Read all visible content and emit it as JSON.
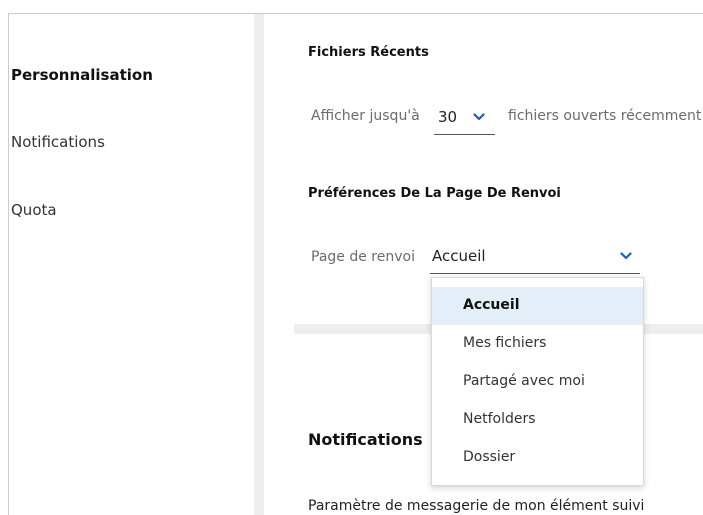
{
  "sidebar": {
    "items": [
      {
        "label": "Personnalisation",
        "active": true
      },
      {
        "label": "Notifications",
        "active": false
      },
      {
        "label": "Quota",
        "active": false
      }
    ]
  },
  "recent_files": {
    "title": "Fichiers Récents",
    "show_prefix": "Afficher jusqu'à",
    "count_value": "30",
    "show_suffix": "fichiers ouverts récemment"
  },
  "landing_page": {
    "title": "Préférences De La Page De Renvoi",
    "label": "Page de renvoi",
    "selected_value": "Accueil",
    "options": [
      "Accueil",
      "Mes fichiers",
      "Partagé avec moi",
      "Netfolders",
      "Dossier"
    ]
  },
  "notifications_section": {
    "title": "Notifications",
    "email_setting_label": "Paramètre de messagerie de mon élément suivi"
  },
  "icons": {
    "chevron": "chevron-down-icon"
  },
  "colors": {
    "accent": "#1a5fb4",
    "highlight": "#e4eef9",
    "divider": "#eeeeef"
  }
}
